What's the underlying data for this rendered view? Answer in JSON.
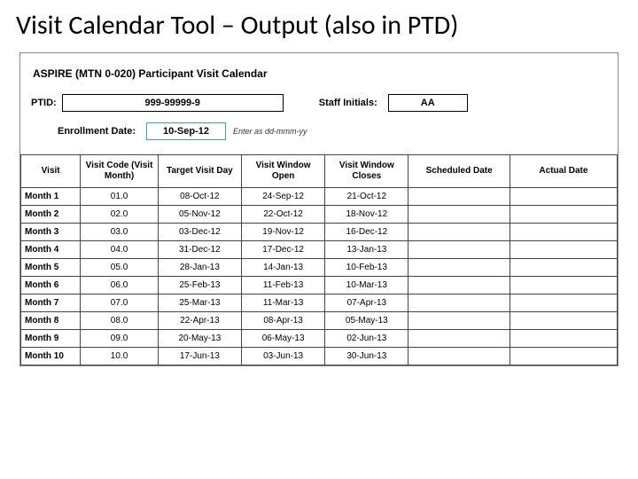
{
  "slide_title": "Visit Calendar Tool – Output (also in PTD)",
  "doc": {
    "title": "ASPIRE (MTN 0-020) Participant Visit Calendar",
    "ptid_label": "PTID:",
    "ptid_value": "999-99999-9",
    "staff_label": "Staff Initials:",
    "staff_value": "AA",
    "enroll_label": "Enrollment Date:",
    "enroll_value": "10-Sep-12",
    "enroll_hint": "Enter as dd-mmm-yy"
  },
  "table": {
    "headers": {
      "visit": "Visit",
      "code": "Visit Code (Visit Month)",
      "target": "Target Visit Day",
      "open": "Visit Window Open",
      "close": "Visit Window Closes",
      "scheduled": "Scheduled Date",
      "actual": "Actual Date"
    },
    "rows": [
      {
        "visit": "Month 1",
        "code": "01.0",
        "target": "08-Oct-12",
        "open": "24-Sep-12",
        "close": "21-Oct-12",
        "scheduled": "",
        "actual": ""
      },
      {
        "visit": "Month 2",
        "code": "02.0",
        "target": "05-Nov-12",
        "open": "22-Oct-12",
        "close": "18-Nov-12",
        "scheduled": "",
        "actual": ""
      },
      {
        "visit": "Month 3",
        "code": "03.0",
        "target": "03-Dec-12",
        "open": "19-Nov-12",
        "close": "16-Dec-12",
        "scheduled": "",
        "actual": ""
      },
      {
        "visit": "Month 4",
        "code": "04.0",
        "target": "31-Dec-12",
        "open": "17-Dec-12",
        "close": "13-Jan-13",
        "scheduled": "",
        "actual": ""
      },
      {
        "visit": "Month 5",
        "code": "05.0",
        "target": "28-Jan-13",
        "open": "14-Jan-13",
        "close": "10-Feb-13",
        "scheduled": "",
        "actual": ""
      },
      {
        "visit": "Month 6",
        "code": "06.0",
        "target": "25-Feb-13",
        "open": "11-Feb-13",
        "close": "10-Mar-13",
        "scheduled": "",
        "actual": ""
      },
      {
        "visit": "Month 7",
        "code": "07.0",
        "target": "25-Mar-13",
        "open": "11-Mar-13",
        "close": "07-Apr-13",
        "scheduled": "",
        "actual": ""
      },
      {
        "visit": "Month 8",
        "code": "08.0",
        "target": "22-Apr-13",
        "open": "08-Apr-13",
        "close": "05-May-13",
        "scheduled": "",
        "actual": ""
      },
      {
        "visit": "Month 9",
        "code": "09.0",
        "target": "20-May-13",
        "open": "06-May-13",
        "close": "02-Jun-13",
        "scheduled": "",
        "actual": ""
      },
      {
        "visit": "Month 10",
        "code": "10.0",
        "target": "17-Jun-13",
        "open": "03-Jun-13",
        "close": "30-Jun-13",
        "scheduled": "",
        "actual": ""
      }
    ]
  }
}
